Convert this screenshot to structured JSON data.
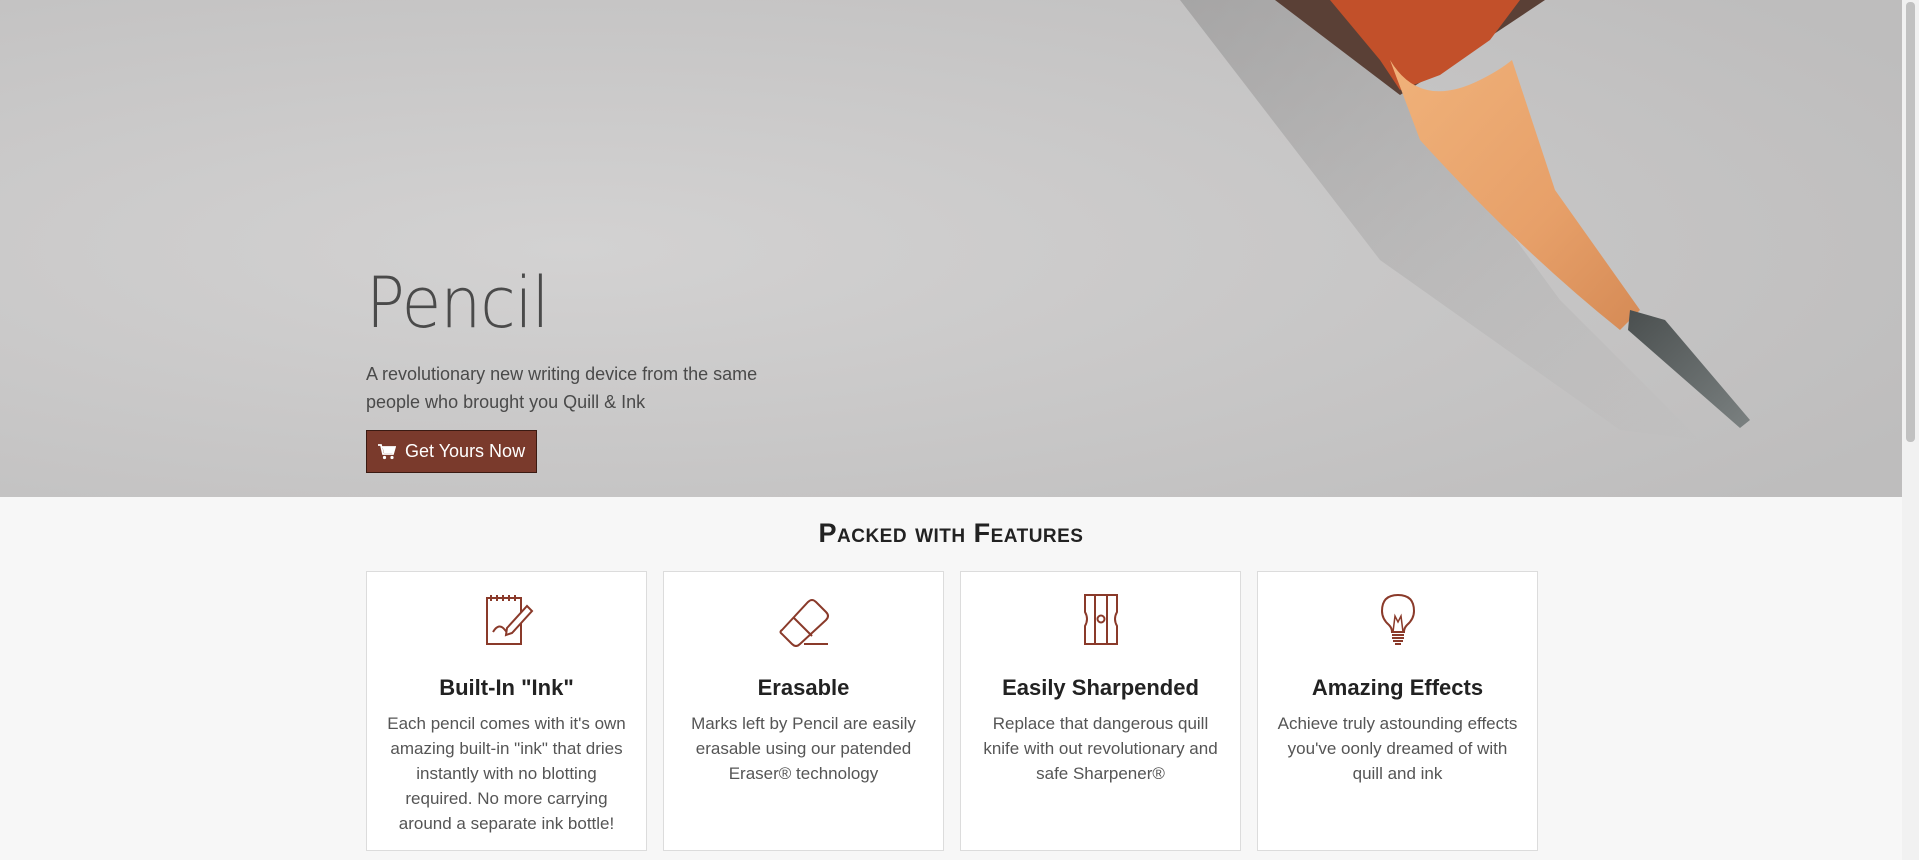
{
  "hero": {
    "title": "Pencil",
    "tagline": "A revolutionary new writing device from the same people who brought you Quill & Ink",
    "cta_label": "Get Yours Now"
  },
  "features": {
    "heading": "Packed with Features",
    "cards": [
      {
        "icon": "notepad-pencil-icon",
        "title": "Built-In \"Ink\"",
        "text": "Each pencil comes with it's own amazing built-in \"ink\" that dries instantly with no blotting required. No more carrying around a separate ink bottle!"
      },
      {
        "icon": "eraser-icon",
        "title": "Erasable",
        "text": "Marks left by Pencil are easily erasable using our patended Eraser® technology"
      },
      {
        "icon": "sharpener-icon",
        "title": "Easily Sharpended",
        "text": "Replace that dangerous quill knife with out revolutionary and safe Sharpener®"
      },
      {
        "icon": "lightbulb-icon",
        "title": "Amazing Effects",
        "text": "Achieve truly astounding effects you've oonly dreamed of with quill and ink"
      }
    ]
  },
  "colors": {
    "accent": "#7a3a2c",
    "icon": "#8a3a2a"
  }
}
